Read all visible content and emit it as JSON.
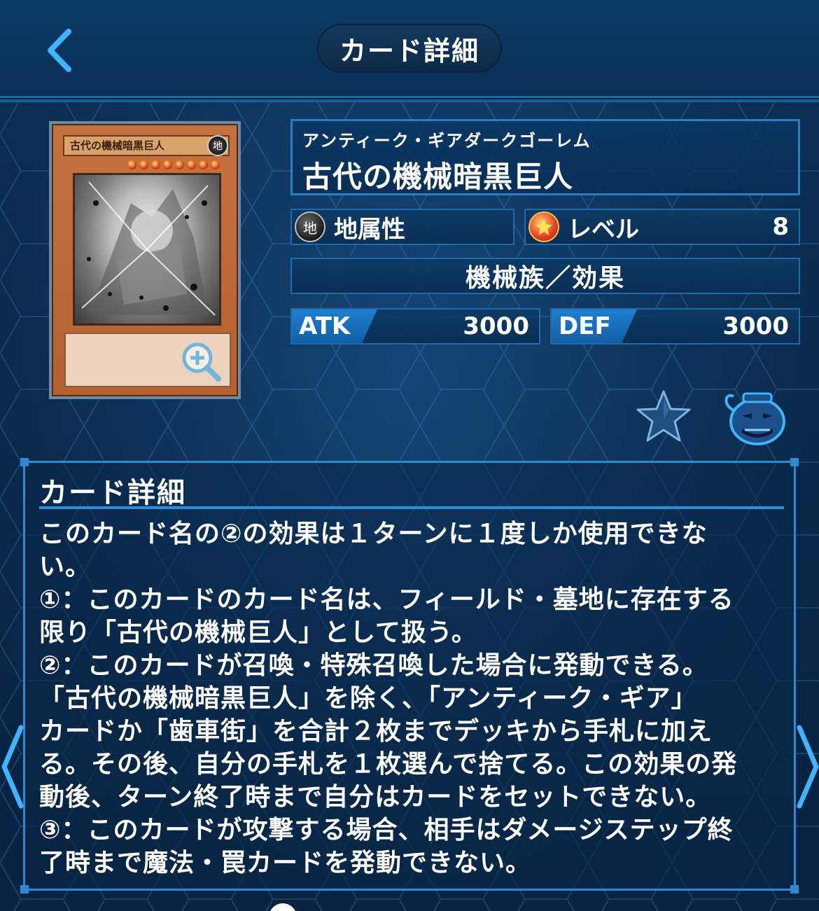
{
  "header": {
    "title": "カード詳細",
    "back_icon": "chevron-left-icon"
  },
  "card": {
    "image_name_text": "古代の機械暗黒巨人",
    "image_attribute_glyph": "地",
    "ruby": "アンティーク・ギアダークゴーレム",
    "name": "古代の機械暗黒巨人",
    "attribute": "地属性",
    "attribute_glyph": "地",
    "level_label": "レベル",
    "level": "8",
    "type": "機械族／効果",
    "atk_label": "ATK",
    "atk": "3000",
    "def_label": "DEF",
    "def": "3000",
    "frame_color": "#c4733f"
  },
  "icons": {
    "zoom": "zoom-in-icon",
    "favorite": "star-icon",
    "pot": "pot-of-greed-icon"
  },
  "detail": {
    "heading": "カード詳細",
    "lines": [
      "このカード名の②の効果は１ターンに１度しか使用できな",
      "い。",
      "①：このカードのカード名は、フィールド・墓地に存在する",
      "限り「古代の機械巨人」として扱う。",
      "②：このカードが召喚・特殊召喚した場合に発動できる。",
      "「古代の機械暗黒巨人」を除く、「アンティーク・ギア」",
      "カードか「歯車街」を合計２枚までデッキから手札に加え",
      "る。その後、自分の手札を１枚選んで捨てる。この効果の発",
      "動後、ターン終了時まで自分はカードをセットできない。",
      "③：このカードが攻撃する場合、相手はダメージステップ終",
      "了時まで魔法・罠カードを発動できない。"
    ]
  },
  "colors": {
    "accent": "#2d8ad0",
    "background": "#0a2a4c"
  }
}
